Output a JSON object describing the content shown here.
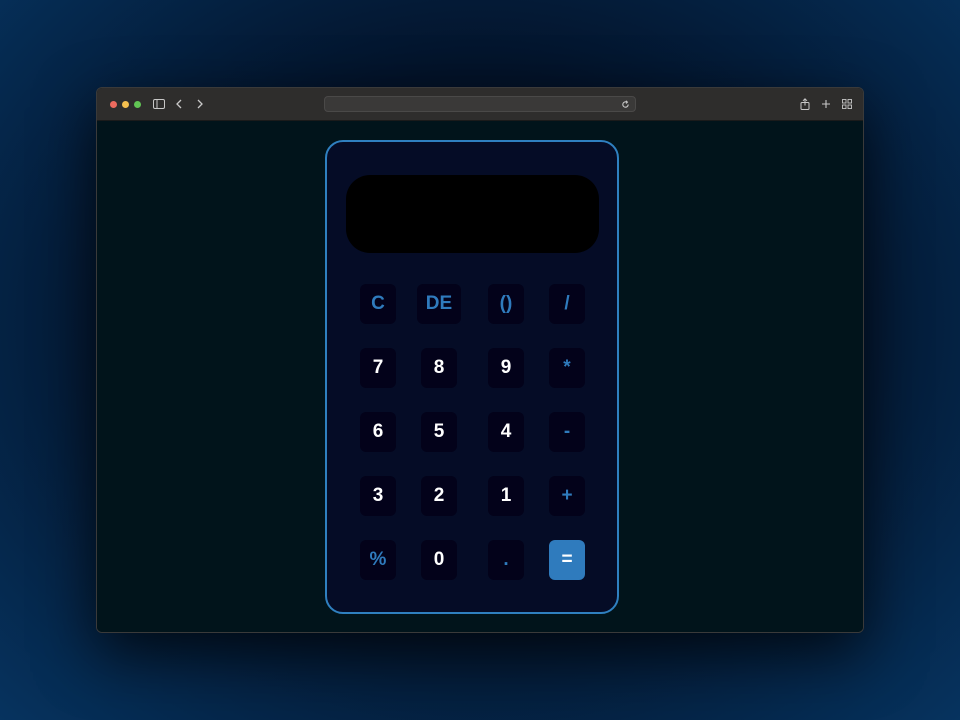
{
  "browser": {
    "url": ""
  },
  "calculator": {
    "display_value": "",
    "keys": [
      {
        "label": "C",
        "kind": "op"
      },
      {
        "label": "DE",
        "kind": "op"
      },
      {
        "label": "()",
        "kind": "op"
      },
      {
        "label": "/",
        "kind": "op"
      },
      {
        "label": "7",
        "kind": "digit"
      },
      {
        "label": "8",
        "kind": "digit"
      },
      {
        "label": "9",
        "kind": "digit"
      },
      {
        "label": "*",
        "kind": "op"
      },
      {
        "label": "6",
        "kind": "digit"
      },
      {
        "label": "5",
        "kind": "digit"
      },
      {
        "label": "4",
        "kind": "digit"
      },
      {
        "label": "-",
        "kind": "op"
      },
      {
        "label": "3",
        "kind": "digit"
      },
      {
        "label": "2",
        "kind": "digit"
      },
      {
        "label": "1",
        "kind": "digit"
      },
      {
        "label": "+",
        "kind": "op"
      },
      {
        "label": "%",
        "kind": "op"
      },
      {
        "label": "0",
        "kind": "digit"
      },
      {
        "label": ".",
        "kind": "op"
      },
      {
        "label": "=",
        "kind": "equals"
      }
    ]
  },
  "colors": {
    "accent": "#2f7bbd",
    "panel": "#050c26",
    "key_background": "#03021a",
    "page_background": "#01141b"
  }
}
